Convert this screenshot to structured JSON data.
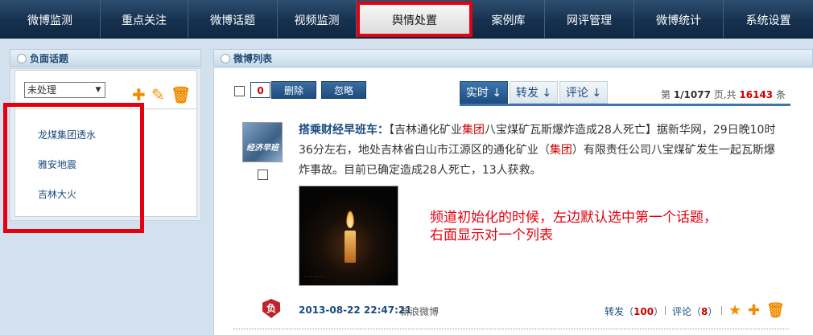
{
  "nav": {
    "items": [
      {
        "label": "微博监测"
      },
      {
        "label": "重点关注"
      },
      {
        "label": "微博话题"
      },
      {
        "label": "视频监测"
      },
      {
        "label": "舆情处置"
      },
      {
        "label": "案例库"
      },
      {
        "label": "网评管理"
      },
      {
        "label": "微博统计"
      },
      {
        "label": "系统设置"
      }
    ],
    "active": "舆情处置"
  },
  "left_panel": {
    "title": "负面话题",
    "filter_value": "未处理",
    "topics": [
      {
        "label": "龙煤集团透水"
      },
      {
        "label": "雅安地震"
      },
      {
        "label": "吉林大火"
      }
    ]
  },
  "right_panel": {
    "title": "微博列表",
    "selected_count": "0",
    "delete_label": "删除",
    "ignore_label": "忽略",
    "tabs": [
      {
        "label": "实时 ↓"
      },
      {
        "label": "转发 ↓"
      },
      {
        "label": "评论 ↓"
      }
    ],
    "pager": {
      "prefix": "第",
      "page": "1/1077",
      "mid": "页,共",
      "total": "16143",
      "suffix": "条"
    }
  },
  "post": {
    "author": "搭乘财经早班车：",
    "text_1": "【吉林通化矿业",
    "hl_1": "集团",
    "text_2": "八宝煤矿瓦斯爆炸造成28人死亡】据新华网，29日晚10时36分左右，地处吉林省白山市江源区的通化矿业（",
    "hl_2": "集团",
    "text_3": "）有限责任公司八宝煤矿发生一起瓦斯爆炸事故。目前已确定造成28人死亡，13人获救。",
    "badge": "负",
    "time": "2013-08-22 22:47:21",
    "source": "新浪微博",
    "repost_label": "转发（",
    "repost_count": "100",
    "repost_close": "）",
    "comment_label": "评论（",
    "comment_count": "8",
    "comment_close": "）"
  },
  "annotation": {
    "line1": "频道初始化的时候，左边默认选中第一个话题，",
    "line2": "右面显示对一个列表"
  }
}
